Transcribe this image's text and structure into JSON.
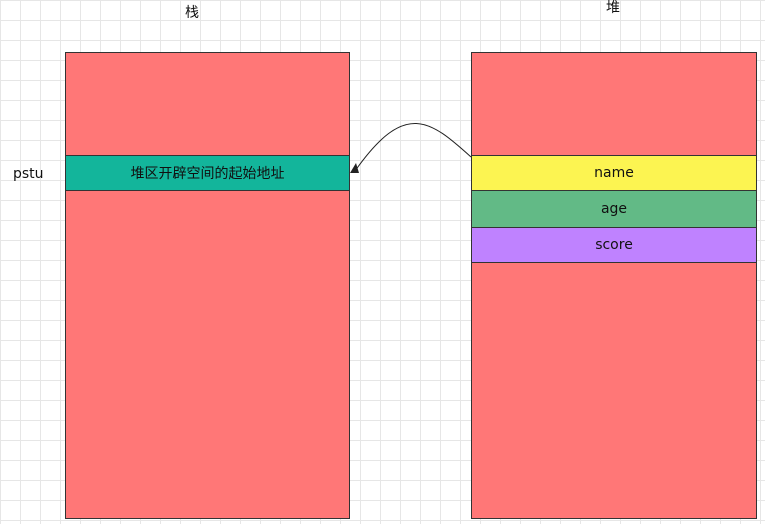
{
  "stack": {
    "title": "栈",
    "pointer_label": "pstu",
    "cell_text": "堆区开辟空间的起始地址"
  },
  "heap": {
    "title": "堆",
    "fields": [
      "name",
      "age",
      "score"
    ]
  },
  "colors": {
    "block": "#ff7777",
    "stack_cell": "#13b59b",
    "name": "#fcf451",
    "age": "#62ba86",
    "score": "#bf82ff"
  }
}
